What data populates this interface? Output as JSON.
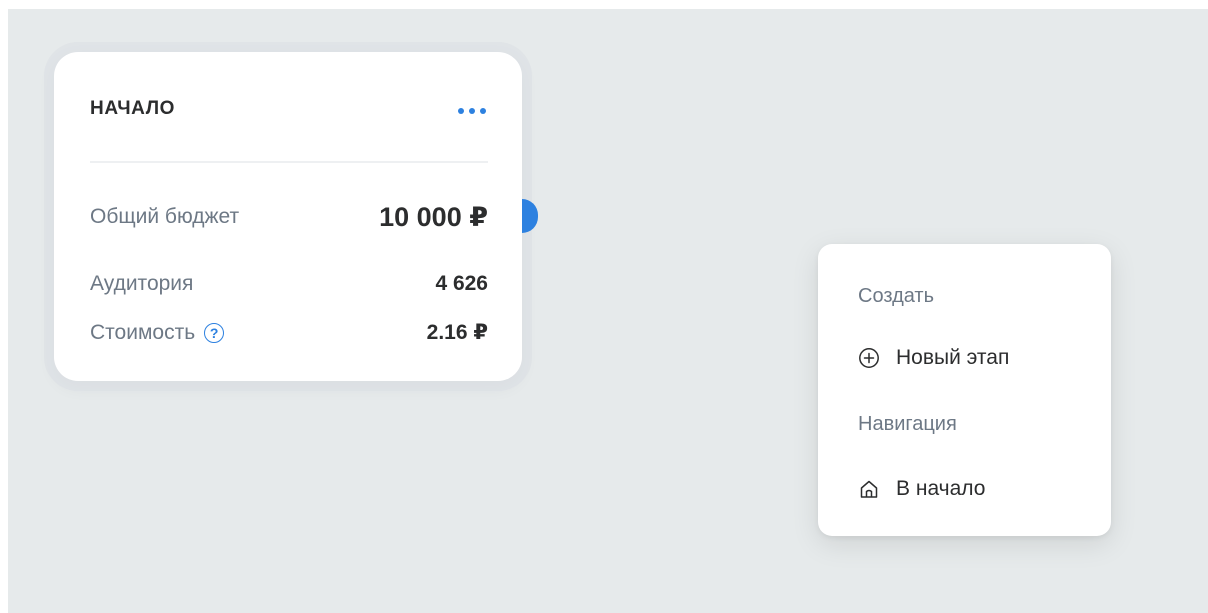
{
  "stage_card": {
    "title": "НАЧАЛО",
    "more_icon": "more-horizontal-icon",
    "metrics": [
      {
        "label": "Общий бюджет",
        "value": "10 000 ₽"
      },
      {
        "label": "Аудитория",
        "value": "4 626"
      },
      {
        "label": "Стоимость",
        "value": "2.16 ₽",
        "help_icon": "question-circle-icon"
      }
    ]
  },
  "context_menu": {
    "sections": [
      {
        "label": "Создать",
        "items": [
          {
            "label": "Новый этап",
            "icon": "plus-circle-icon"
          }
        ]
      },
      {
        "label": "Навигация",
        "items": [
          {
            "label": "В начало",
            "icon": "home-icon"
          }
        ]
      }
    ]
  },
  "colors": {
    "accent": "#2d81e0",
    "canvas_background": "#e6eaeb",
    "text_primary": "#2c2d2e",
    "text_secondary": "#6d7885"
  }
}
